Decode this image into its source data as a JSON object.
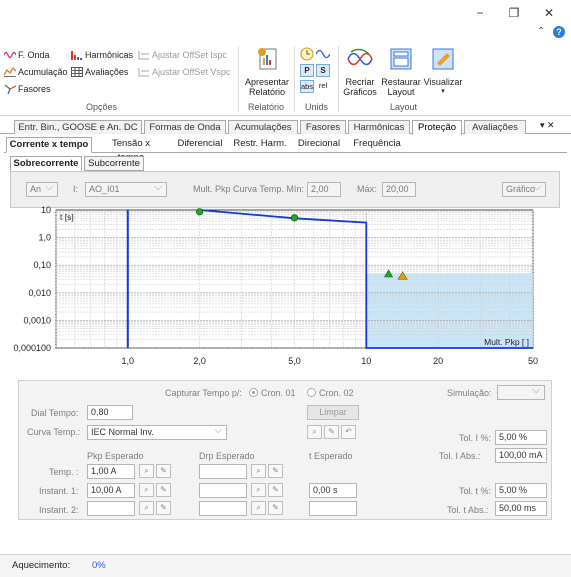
{
  "window": {
    "minimize": "−",
    "restore": "❐",
    "close": "✕",
    "help": "?"
  },
  "ribbon": {
    "col1": [
      "F. Onda",
      "Acumulação",
      "Fasores"
    ],
    "col2": [
      "Harmônicas",
      "Avaliações"
    ],
    "col3": [
      "Ajustar OffSet Ispc",
      "Ajustar OffSet Vspc"
    ],
    "group_opcoes": "Opções",
    "apresentar": "Apresentar Relatório",
    "group_relatorio": "Relatório",
    "units": {
      "abs": "abs",
      "rel": "rel"
    },
    "group_unids": "Unids",
    "recriar": "Recriar Gráficos",
    "restaurar": "Restaurar Layout",
    "visualizar": "Visualizar",
    "group_layout": "Layout"
  },
  "tabs_main": [
    "Entr. Bin., GOOSE e An. DC",
    "Formas de Onda",
    "Acumulações",
    "Fasores",
    "Harmônicas",
    "Proteção",
    "Avaliações"
  ],
  "tabs_main_pin": "▾ ✕",
  "tabs_sub": [
    "Corrente x tempo",
    "Tensão x tempo",
    "Diferencial",
    "Restr. Harm.",
    "Direcional",
    "Frequência"
  ],
  "tabs_curve": [
    "Sobrecorrente",
    "Subcorrente"
  ],
  "selector": {
    "mode": "An",
    "i_label": "I:",
    "channel": "AO_I01",
    "mult_label": "Mult. Pkp Curva Temp. Mín:",
    "mult_min": "2,00",
    "max_label": "Máx:",
    "mult_max": "20,00",
    "view": "Gráfico"
  },
  "chart_data": {
    "type": "line",
    "x_scale": "log",
    "y_scale": "log",
    "x_ticks": [
      "1,0",
      "2,0",
      "5,0",
      "10",
      "20",
      "50"
    ],
    "y_ticks": [
      "10",
      "1,0",
      "0,10",
      "0,010",
      "0,0010",
      "0,000100"
    ],
    "y_unit_label": "t [s]",
    "x_unit_label": "Mult. Pkp [ ]",
    "xlim": [
      0.5,
      50
    ],
    "ylim": [
      0.0001,
      10
    ],
    "grid": true,
    "series": [
      {
        "points": [
          [
            2.0,
            10
          ],
          [
            5.0,
            5
          ],
          [
            10,
            3.5
          ],
          [
            10,
            0.0001
          ],
          [
            50,
            0.0001
          ]
        ],
        "color": "#1538d8"
      }
    ],
    "vertical_line_x": 1.0,
    "markers": [
      {
        "x": 2.0,
        "y": 8.6,
        "kind": "circle",
        "color": "#22a822"
      },
      {
        "x": 5.0,
        "y": 5.2,
        "kind": "circle",
        "color": "#22a822"
      },
      {
        "x": 12.4,
        "y": 0.048,
        "kind": "triangle",
        "color": "#1fa81f"
      },
      {
        "x": 14.2,
        "y": 0.041,
        "kind": "warning",
        "color": "#e6a000"
      }
    ],
    "shaded_region": {
      "x_from": 10,
      "x_to": 50,
      "y_from": 0.0001,
      "y_to": 0.05,
      "color": "#bfe0f4"
    }
  },
  "form": {
    "capturar_label": "Capturar Tempo p/:",
    "cron1": "Cron. 01",
    "cron2": "Cron. 02",
    "simulacao_label": "Simulação:",
    "dial_label": "Dial Tempo:",
    "dial_value": "0,80",
    "limpar": "Limpar",
    "curva_label": "Curva Temp.:",
    "curva_value": "IEC Normal Inv.",
    "tol_i_pct_label": "Tol. I %:",
    "tol_i_pct": "5,00 %",
    "tol_i_abs_label": "Tol. I Abs.:",
    "tol_i_abs": "100,00 mA",
    "pkp_header": "Pkp Esperado",
    "drp_header": "Drp Esperado",
    "t_header": "t Esperado",
    "temp_label": "Temp. :",
    "temp_pkp": "1,00 A",
    "inst1_label": "Instant. 1:",
    "inst1_pkp": "10,00 A",
    "inst1_t": "0,00 s",
    "inst2_label": "Instant. 2:",
    "tol_t_pct_label": "Tol. t %:",
    "tol_t_pct": "5,00 %",
    "tol_t_abs_label": "Tol. t Abs.:",
    "tol_t_abs": "50,00 ms"
  },
  "status": {
    "label": "Aquecimento:",
    "value": "0%"
  }
}
